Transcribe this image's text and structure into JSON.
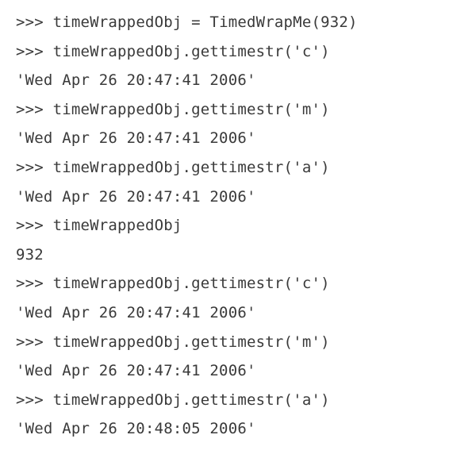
{
  "prompt": ">>>",
  "lines": [
    {
      "kind": "input",
      "text": "timeWrappedObj = TimedWrapMe(932)"
    },
    {
      "kind": "input",
      "text": "timeWrappedObj.gettimestr('c')"
    },
    {
      "kind": "output",
      "text": "'Wed Apr 26 20:47:41 2006'"
    },
    {
      "kind": "input",
      "text": "timeWrappedObj.gettimestr('m')"
    },
    {
      "kind": "output",
      "text": "'Wed Apr 26 20:47:41 2006'"
    },
    {
      "kind": "input",
      "text": "timeWrappedObj.gettimestr('a')"
    },
    {
      "kind": "output",
      "text": "'Wed Apr 26 20:47:41 2006'"
    },
    {
      "kind": "input",
      "text": "timeWrappedObj"
    },
    {
      "kind": "output",
      "text": "932"
    },
    {
      "kind": "input",
      "text": "timeWrappedObj.gettimestr('c')"
    },
    {
      "kind": "output",
      "text": "'Wed Apr 26 20:47:41 2006'"
    },
    {
      "kind": "input",
      "text": "timeWrappedObj.gettimestr('m')"
    },
    {
      "kind": "output",
      "text": "'Wed Apr 26 20:47:41 2006'"
    },
    {
      "kind": "input",
      "text": "timeWrappedObj.gettimestr('a')"
    },
    {
      "kind": "output",
      "text": "'Wed Apr 26 20:48:05 2006'"
    }
  ]
}
